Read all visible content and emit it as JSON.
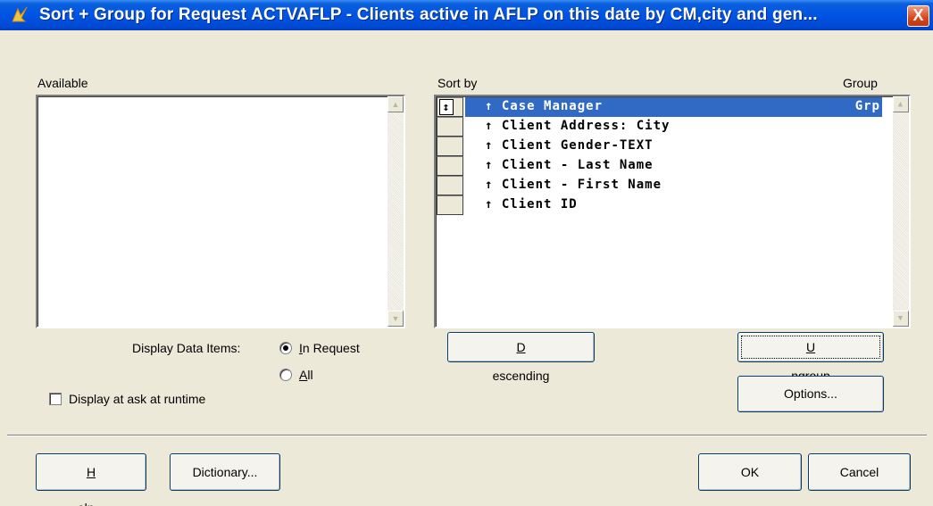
{
  "window": {
    "title": "Sort + Group for Request ACTVAFLP - Clients active in AFLP on this date by CM,city and gen...",
    "close_symbol": "X"
  },
  "available": {
    "label": "Available",
    "items": []
  },
  "sort_by": {
    "label": "Sort by",
    "group_label": "Group",
    "items": [
      {
        "direction": "↑",
        "name": "Case Manager",
        "group": "Grp",
        "selected": true
      },
      {
        "direction": "↑",
        "name": "Client Address: City",
        "group": "",
        "selected": false
      },
      {
        "direction": "↑",
        "name": "Client Gender-TEXT",
        "group": "",
        "selected": false
      },
      {
        "direction": "↑",
        "name": "Client - Last Name",
        "group": "",
        "selected": false
      },
      {
        "direction": "↑",
        "name": "Client - First Name",
        "group": "",
        "selected": false
      },
      {
        "direction": "↑",
        "name": "Client ID",
        "group": "",
        "selected": false
      }
    ]
  },
  "display_data_items": {
    "label": "Display Data Items:",
    "options": [
      {
        "label": "In Request",
        "mnemonic": "I",
        "rest": "n Request",
        "checked": true
      },
      {
        "label": "All",
        "mnemonic": "A",
        "rest": "ll",
        "checked": false
      }
    ]
  },
  "display_at_ask": {
    "label": "Display at ask at runtime",
    "checked": false
  },
  "buttons": {
    "descending": {
      "mnemonic": "D",
      "rest": "escending"
    },
    "ungroup": {
      "mnemonic": "U",
      "rest": "ngroup"
    },
    "options": "Options...",
    "help": {
      "mnemonic": "H",
      "rest": "elp..."
    },
    "dictionary": "Dictionary...",
    "ok": "OK",
    "cancel": "Cancel"
  },
  "icons": {
    "sort_handle": "↕",
    "scroll_up": "▲",
    "scroll_down": "▼"
  }
}
